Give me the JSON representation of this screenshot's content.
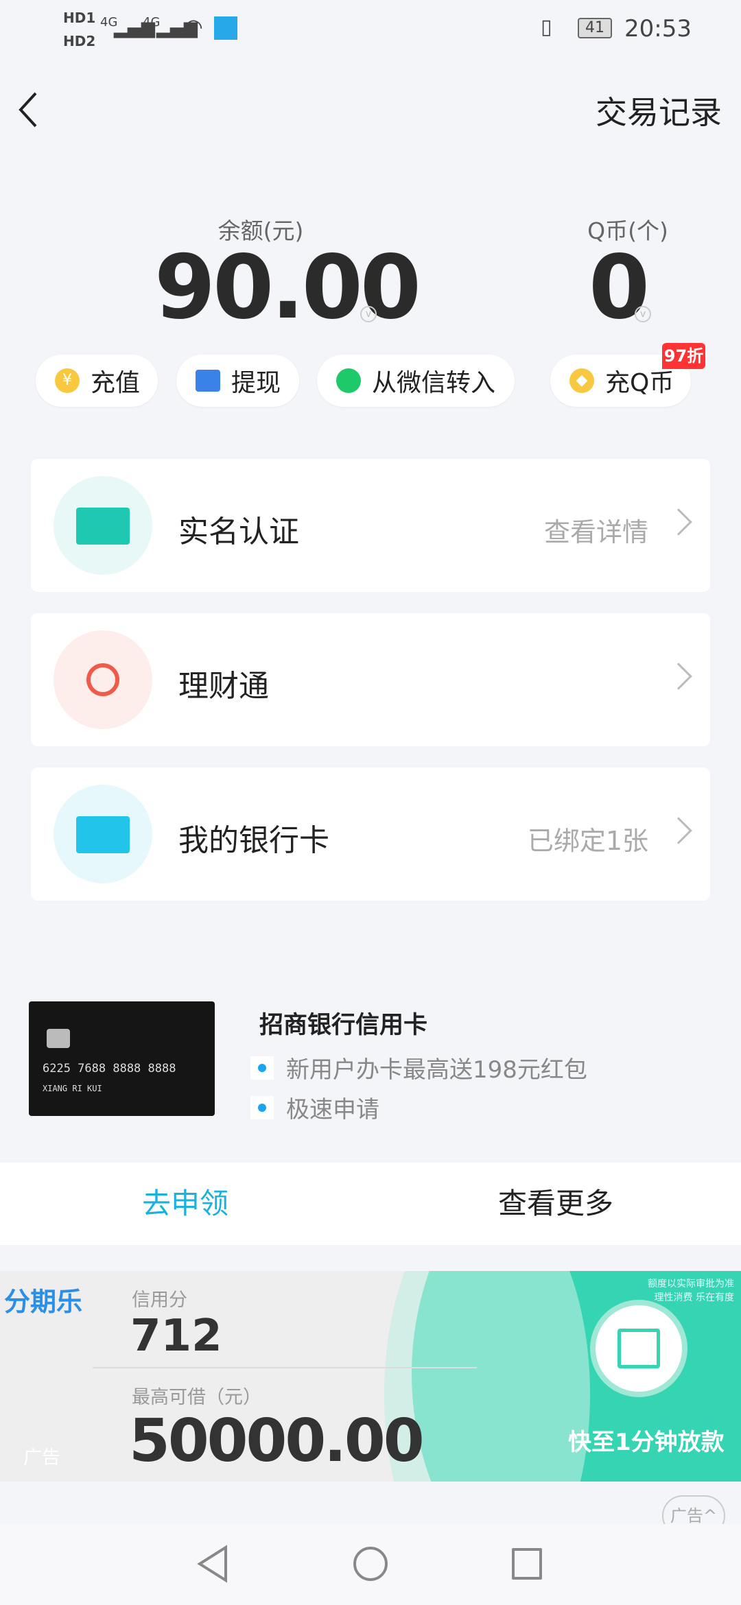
{
  "status_bar": {
    "sim1": "HD1",
    "sim2": "HD2",
    "network1": "4G",
    "network2": "4G",
    "battery": "41",
    "time": "20:53"
  },
  "header": {
    "back_icon": "chevron-left-icon",
    "transactions_link": "交易记录"
  },
  "balance": {
    "label": "余额(元)",
    "value": "90.00"
  },
  "qcoin": {
    "label": "Q币(个)",
    "value": "0"
  },
  "actions": [
    {
      "label": "充值",
      "icon": "yuan-coin-icon"
    },
    {
      "label": "提现",
      "icon": "wallet-icon"
    },
    {
      "label": "从微信转入",
      "icon": "wechat-icon"
    },
    {
      "label": "充Q币",
      "icon": "qcoin-icon",
      "badge": "97折"
    }
  ],
  "menu": [
    {
      "label": "实名认证",
      "detail": "查看详情",
      "icon": "id-card-icon",
      "color": "#1fc8b0"
    },
    {
      "label": "理财通",
      "detail": "",
      "icon": "licaitong-icon",
      "color": "#f05a4a"
    },
    {
      "label": "我的银行卡",
      "detail": "已绑定1张",
      "icon": "bank-card-icon",
      "color": "#22c4ea"
    }
  ],
  "promo": {
    "title": "招商银行信用卡",
    "bullets": [
      "新用户办卡最高送198元红包",
      "极速申请"
    ],
    "card_number": "6225 7688 8888 8888",
    "card_name": "XIANG RI KUI",
    "apply": "去申领",
    "more": "查看更多"
  },
  "ad": {
    "brand": "分期乐",
    "score_label": "信用分",
    "score": "712",
    "limit_label": "最高可借（元）",
    "limit": "50000.00",
    "slogan": "快至1分钟放款",
    "disclaimer1": "额度以实际审批为准",
    "disclaimer2": "理性消费 乐在有度",
    "ad_tag": "广告",
    "ad_toggle": "广告"
  },
  "colors": {
    "accent": "#1aa6ee",
    "ad_green": "#35d4b2",
    "badge": "#ff3333"
  }
}
